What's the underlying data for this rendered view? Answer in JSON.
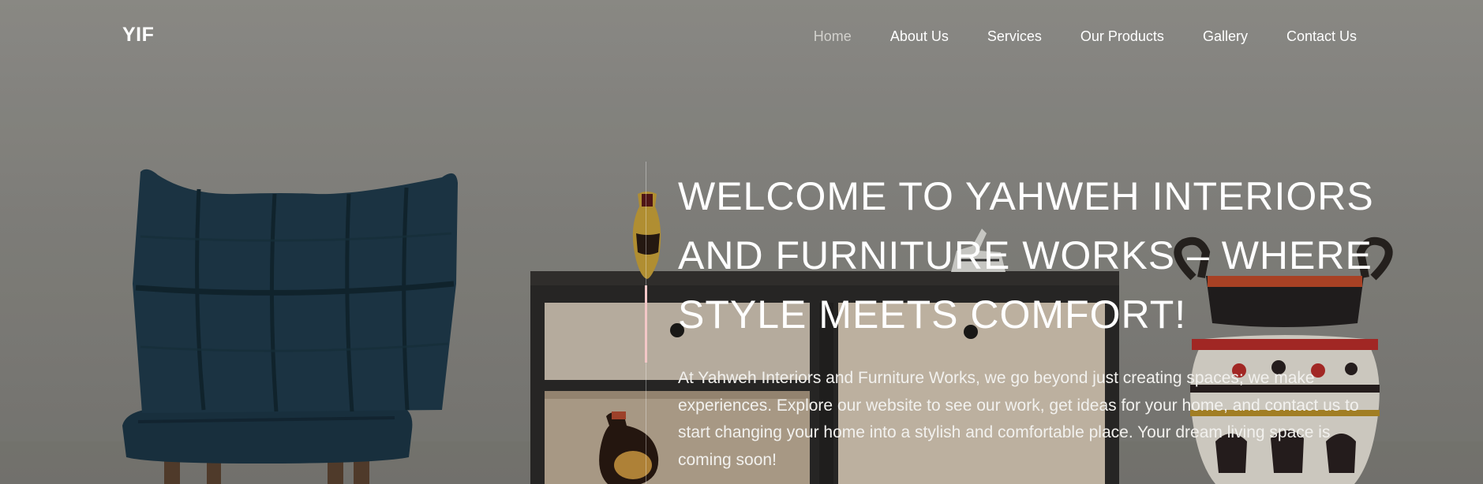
{
  "header": {
    "logo_text": "YIF",
    "nav": [
      {
        "label": "Home",
        "active": true
      },
      {
        "label": "About Us"
      },
      {
        "label": "Services"
      },
      {
        "label": "Our Products"
      },
      {
        "label": "Gallery"
      },
      {
        "label": "Contact Us"
      }
    ]
  },
  "hero": {
    "headline": "WELCOME TO YAHWEH INTERIORS AND FURNITURE WORKS – WHERE STYLE MEETS COMFORT!",
    "intro": "At Yahweh Interiors and Furniture Works, we go beyond just creating spaces; we make experiences. Explore our website to see our work, get ideas for your home, and contact us to start changing your home into a stylish and comfortable place. Your dream living space is coming soon!"
  },
  "colors": {
    "wall": "#9c9b96",
    "chair": "#1f3b4c",
    "cabinet_frame": "#2c2b29",
    "cabinet_panel": "#d9cdbd",
    "accent_line": "#f3c7c7"
  }
}
